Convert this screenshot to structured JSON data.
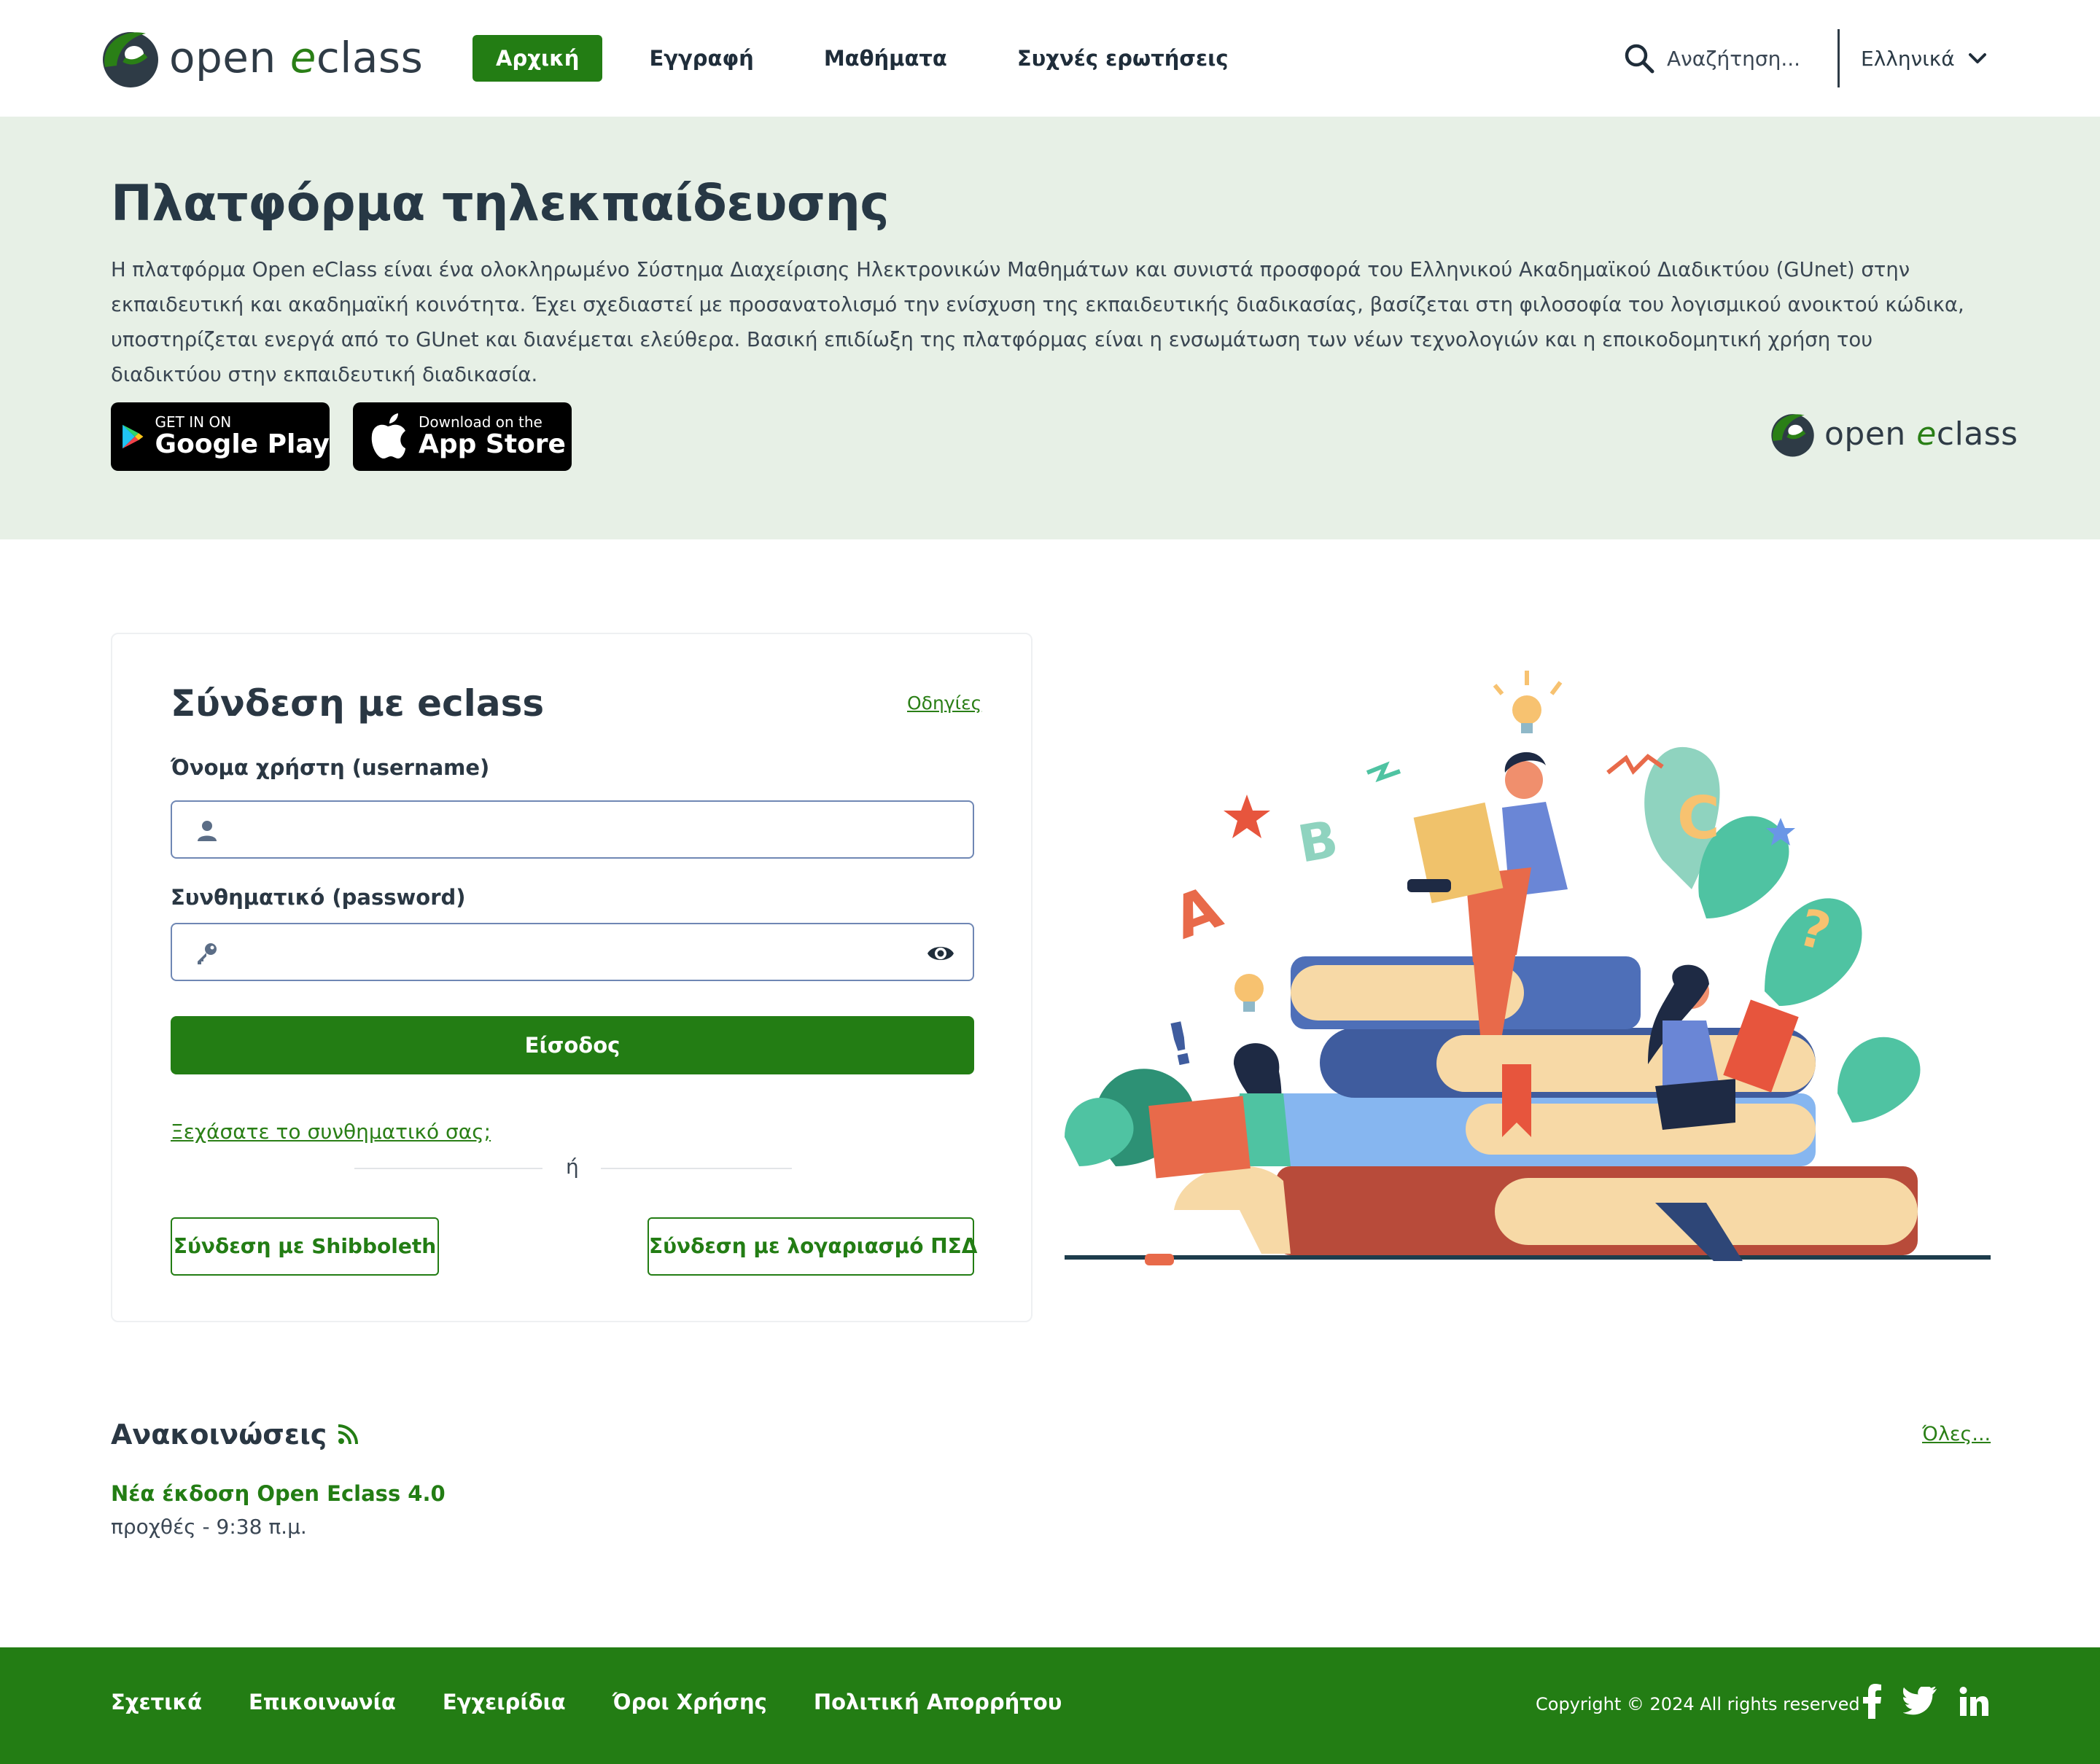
{
  "header": {
    "logo_text_open": "open ",
    "logo_text_e": "e",
    "logo_text_class": "class",
    "nav": [
      {
        "label": "Αρχική",
        "active": true
      },
      {
        "label": "Εγγραφή",
        "active": false
      },
      {
        "label": "Μαθήματα",
        "active": false
      },
      {
        "label": "Συχνές ερωτήσεις",
        "active": false
      }
    ],
    "search_placeholder": "Αναζήτηση...",
    "language": "Ελληνικά"
  },
  "hero": {
    "title": "Πλατφόρμα τηλεκπαίδευσης",
    "description": "Η πλατφόρμα Open eClass είναι ένα ολοκληρωμένο Σύστημα Διαχείρισης Ηλεκτρονικών Μαθημάτων και συνιστά προσφορά του Ελληνικού Ακαδημαϊκού Διαδικτύου (GUnet) στην εκπαιδευτική και ακαδημαϊκή κοινότητα. Έχει σχεδιαστεί με προσανατολισμό την ενίσχυση της εκπαιδευτικής διαδικασίας, βασίζεται στη φιλοσοφία του λογισμικού ανοικτού κώδικα, υποστηρίζεται ενεργά από το GUnet και διανέμεται ελεύθερα. Βασική επιδίωξη της πλατφόρμας είναι η ενσωμάτωση των νέων τεχνολογιών και η εποικοδομητική χρήση του διαδικτύου στην εκπαιδευτική διαδικασία.",
    "google_play_small": "GET IN ON",
    "google_play_big": "Google Play",
    "app_store_small": "Download on the",
    "app_store_big": "App Store"
  },
  "login": {
    "title": "Σύνδεση με eclass",
    "help_link": "Οδηγίες",
    "username_label": "Όνομα χρήστη (username)",
    "username_value": "",
    "password_label": "Συνθηματικό (password)",
    "password_value": "",
    "submit": "Είσοδος",
    "forgot": "Ξεχάσατε το συνθηματικό σας;",
    "or": "ή",
    "shibboleth": "Σύνδεση με Shibboleth",
    "psd": "Σύνδεση με λογαριασμό ΠΣΔ"
  },
  "announcements": {
    "title": "Ανακοινώσεις",
    "all_link": "Όλες...",
    "items": [
      {
        "title": "Νέα έκδοση Open Eclass 4.0",
        "date": "προχθές - 9:38 π.μ."
      }
    ]
  },
  "footer": {
    "links": [
      "Σχετικά",
      "Επικοινωνία",
      "Εγχειρίδια",
      "Όροι Χρήσης",
      "Πολιτική Απορρήτου"
    ],
    "copyright": "Copyright © 2024 All rights reserved",
    "social": [
      "facebook-icon",
      "twitter-icon",
      "linkedin-icon"
    ]
  },
  "colors": {
    "brand_green": "#237d14",
    "hero_bg": "#e7f0e6",
    "text_dark": "#2b3a45",
    "input_border": "#6f87b4"
  }
}
